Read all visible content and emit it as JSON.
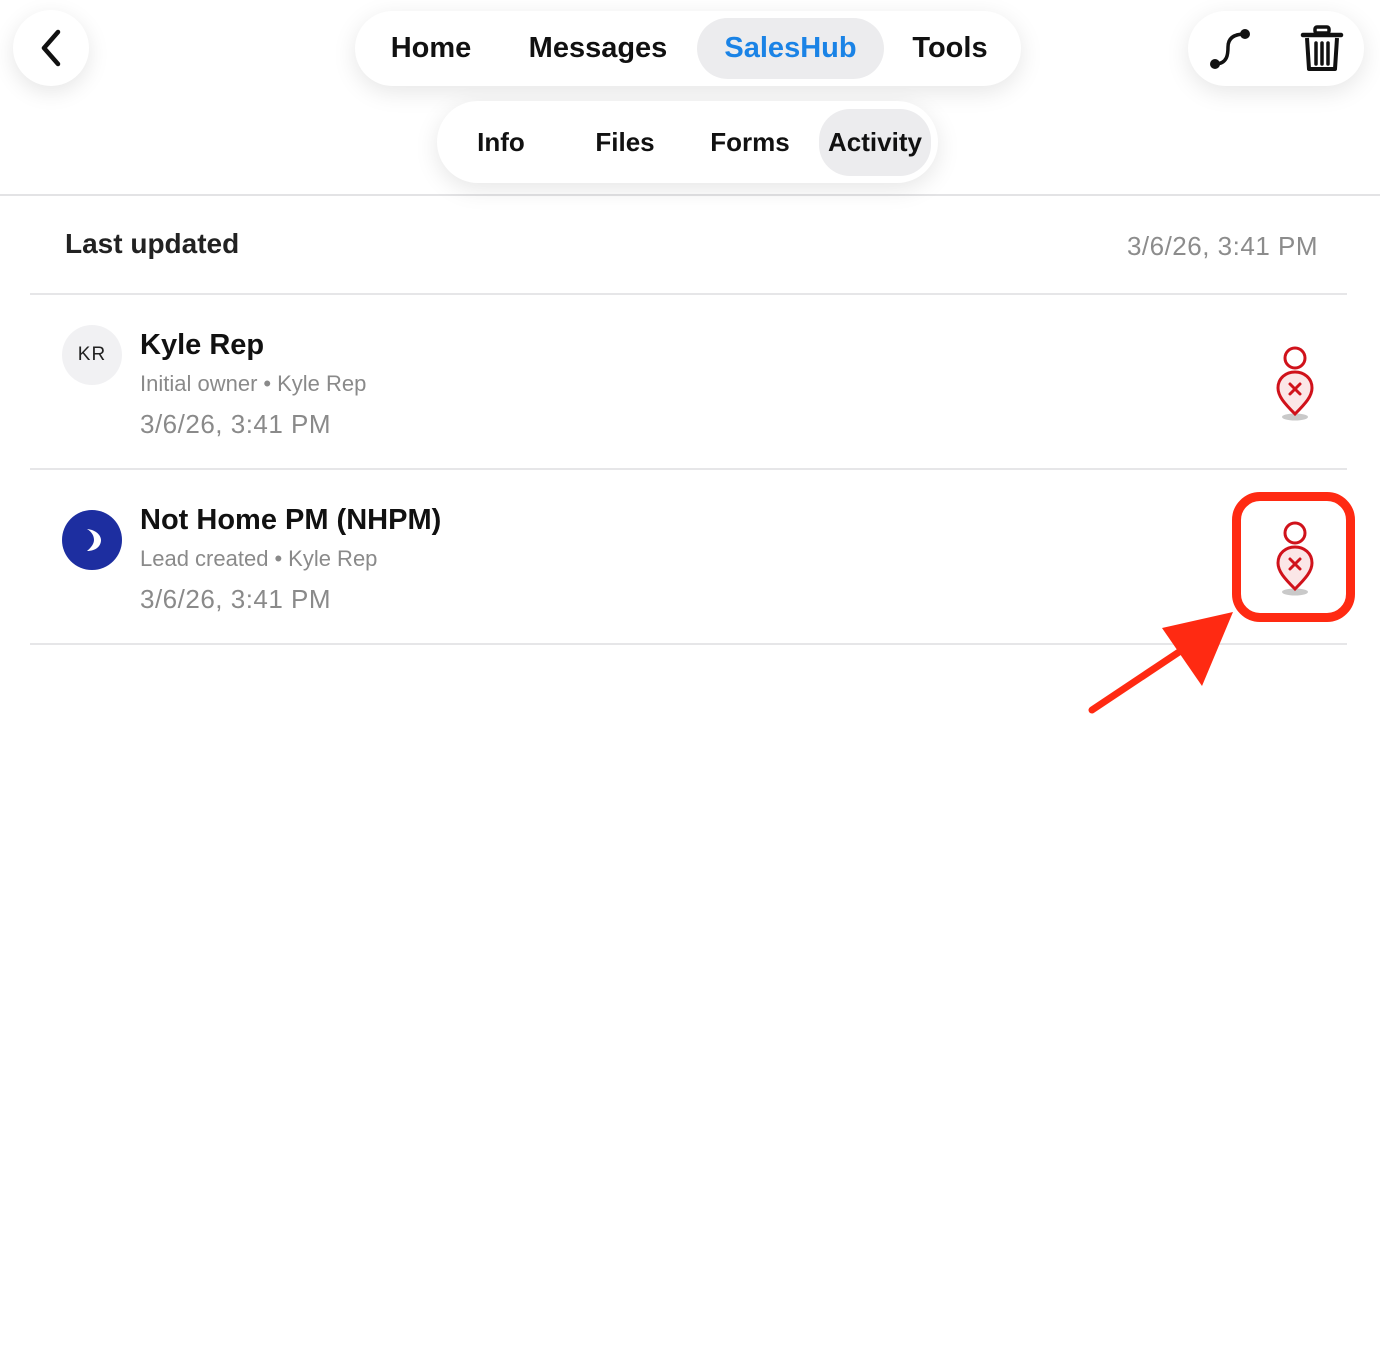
{
  "header": {
    "back_icon": "chevron-left-icon",
    "primary_tabs": [
      {
        "label": "Home",
        "active": false
      },
      {
        "label": "Messages",
        "active": false
      },
      {
        "label": "SalesHub",
        "active": true
      },
      {
        "label": "Tools",
        "active": false
      }
    ],
    "sub_tabs": [
      {
        "label": "Info",
        "active": false
      },
      {
        "label": "Files",
        "active": false
      },
      {
        "label": "Forms",
        "active": false
      },
      {
        "label": "Activity",
        "active": true
      }
    ],
    "actions": [
      {
        "icon": "route-icon"
      },
      {
        "icon": "trash-icon"
      }
    ]
  },
  "summary": {
    "label": "Last updated",
    "value": "3/6/26, 3:41 PM"
  },
  "activity": [
    {
      "avatar": "KR",
      "title": "Kyle Rep",
      "event": "Initial owner",
      "separator": "•",
      "actor": "Kyle Rep",
      "time": "3/6/26, 3:41 PM",
      "pin_icon": "map-pin-x-icon"
    },
    {
      "avatar_icon": "moon-icon",
      "title": "Not Home PM (NHPM)",
      "event": "Lead created",
      "separator": "•",
      "actor": "Kyle Rep",
      "time": "3/6/26, 3:41 PM",
      "pin_icon": "map-pin-x-icon"
    }
  ],
  "colors": {
    "accent": "#1a83e6",
    "pin_red": "#d0121b",
    "moon_avatar": "#1d2ea0",
    "annotation": "#ff2a12",
    "muted_text": "#8a8a8a"
  }
}
